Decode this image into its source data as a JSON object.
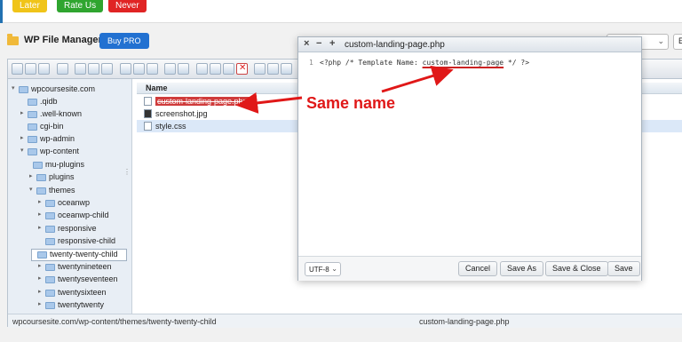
{
  "notice": {
    "later_label": "Later",
    "rate_label": "Rate Us",
    "never_label": "Never"
  },
  "header": {
    "title": "WP File Manager",
    "buy_pro_label": "Buy PRO",
    "lang_text": "E"
  },
  "tree": {
    "items": [
      {
        "label": "wpcoursesite.com"
      },
      {
        "label": ".qidb"
      },
      {
        "label": ".well-known"
      },
      {
        "label": "cgi-bin"
      },
      {
        "label": "wp-admin"
      },
      {
        "label": "wp-content"
      },
      {
        "label": "mu-plugins"
      },
      {
        "label": "plugins"
      },
      {
        "label": "themes"
      },
      {
        "label": "oceanwp"
      },
      {
        "label": "oceanwp-child"
      },
      {
        "label": "responsive"
      },
      {
        "label": "responsive-child"
      },
      {
        "label": "twenty-twenty-child"
      },
      {
        "label": "twentynineteen"
      },
      {
        "label": "twentyseventeen"
      },
      {
        "label": "twentysixteen"
      },
      {
        "label": "twentytwenty"
      }
    ]
  },
  "files": {
    "column_name": "Name",
    "rows": [
      {
        "name": "custom-landing-page.php"
      },
      {
        "name": "screenshot.jpg"
      },
      {
        "name": "style.css"
      }
    ]
  },
  "statusbar": {
    "path": "wpcoursesite.com/wp-content/themes/twenty-twenty-child",
    "filename": "custom-landing-page.php"
  },
  "editor": {
    "title": "custom-landing-page.php",
    "close_glyph": "×",
    "minimize_glyph": "−",
    "maximize_glyph": "+",
    "line_number": "1",
    "code_prefix": "<?php /* Template Name: ",
    "template_name": "custom-landing-page",
    "code_suffix": " */ ?>",
    "encoding": "UTF-8",
    "cancel_label": "Cancel",
    "save_as_label": "Save As",
    "save_close_label": "Save & Close",
    "save_label": "Save"
  },
  "annotation": {
    "text": "Same name",
    "color": "#e01818"
  }
}
